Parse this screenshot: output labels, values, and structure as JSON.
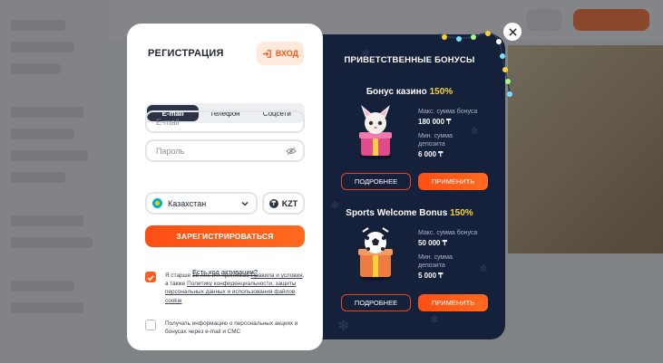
{
  "registration": {
    "title": "РЕГИСТРАЦИЯ",
    "login_label": "ВХОД",
    "tabs": [
      {
        "label": "E-mail",
        "active": true
      },
      {
        "label": "Телефон",
        "active": false
      },
      {
        "label": "Соцсети",
        "active": false
      }
    ],
    "email_placeholder": "E-mail",
    "password_placeholder": "Пароль",
    "country": "Казахстан",
    "currency": "KZT",
    "currency_symbol": "₸",
    "register_label": "ЗАРЕГИСТРИРОВАТЬСЯ",
    "activation_link": "Есть код активации?",
    "age_consent": {
      "checked": true,
      "text_1": "Я старше 18 лет, и я принимаю ",
      "link_1": "Правила и условия",
      "text_2": ", а также ",
      "link_2": "Политику конфиденциальности, защиты персональных данных и использования файлов cookie"
    },
    "promo_consent": {
      "checked": false,
      "text": "Получать информацию о персональных акциях и бонусах через e-mail и СМС"
    }
  },
  "bonuses": {
    "title": "ПРИВЕТСТВЕННЫЕ БОНУСЫ",
    "items": [
      {
        "name": "Бонус казино",
        "percent": "150%",
        "max_label": "Макс. сумма бонуса",
        "max_value": "180 000 ₸",
        "min_label_1": "Мин. сумма",
        "min_label_2": "депозита",
        "min_value": "6 000 ₸",
        "details_label": "ПОДРОБНЕЕ",
        "apply_label": "ПРИМЕНИТЬ"
      },
      {
        "name": "Sports Welcome Bonus",
        "percent": "150%",
        "max_label": "Макс. сумма бонуса",
        "max_value": "50 000 ₸",
        "min_label_1": "Мин. сумма",
        "min_label_2": "депозита",
        "min_value": "5 000 ₸",
        "details_label": "ПОДРОБНЕЕ",
        "apply_label": "ПРИМЕНИТЬ"
      }
    ]
  },
  "colors": {
    "accent": "#ff5a1f",
    "dark_panel": "#15203b",
    "highlight": "#f6d33a"
  }
}
